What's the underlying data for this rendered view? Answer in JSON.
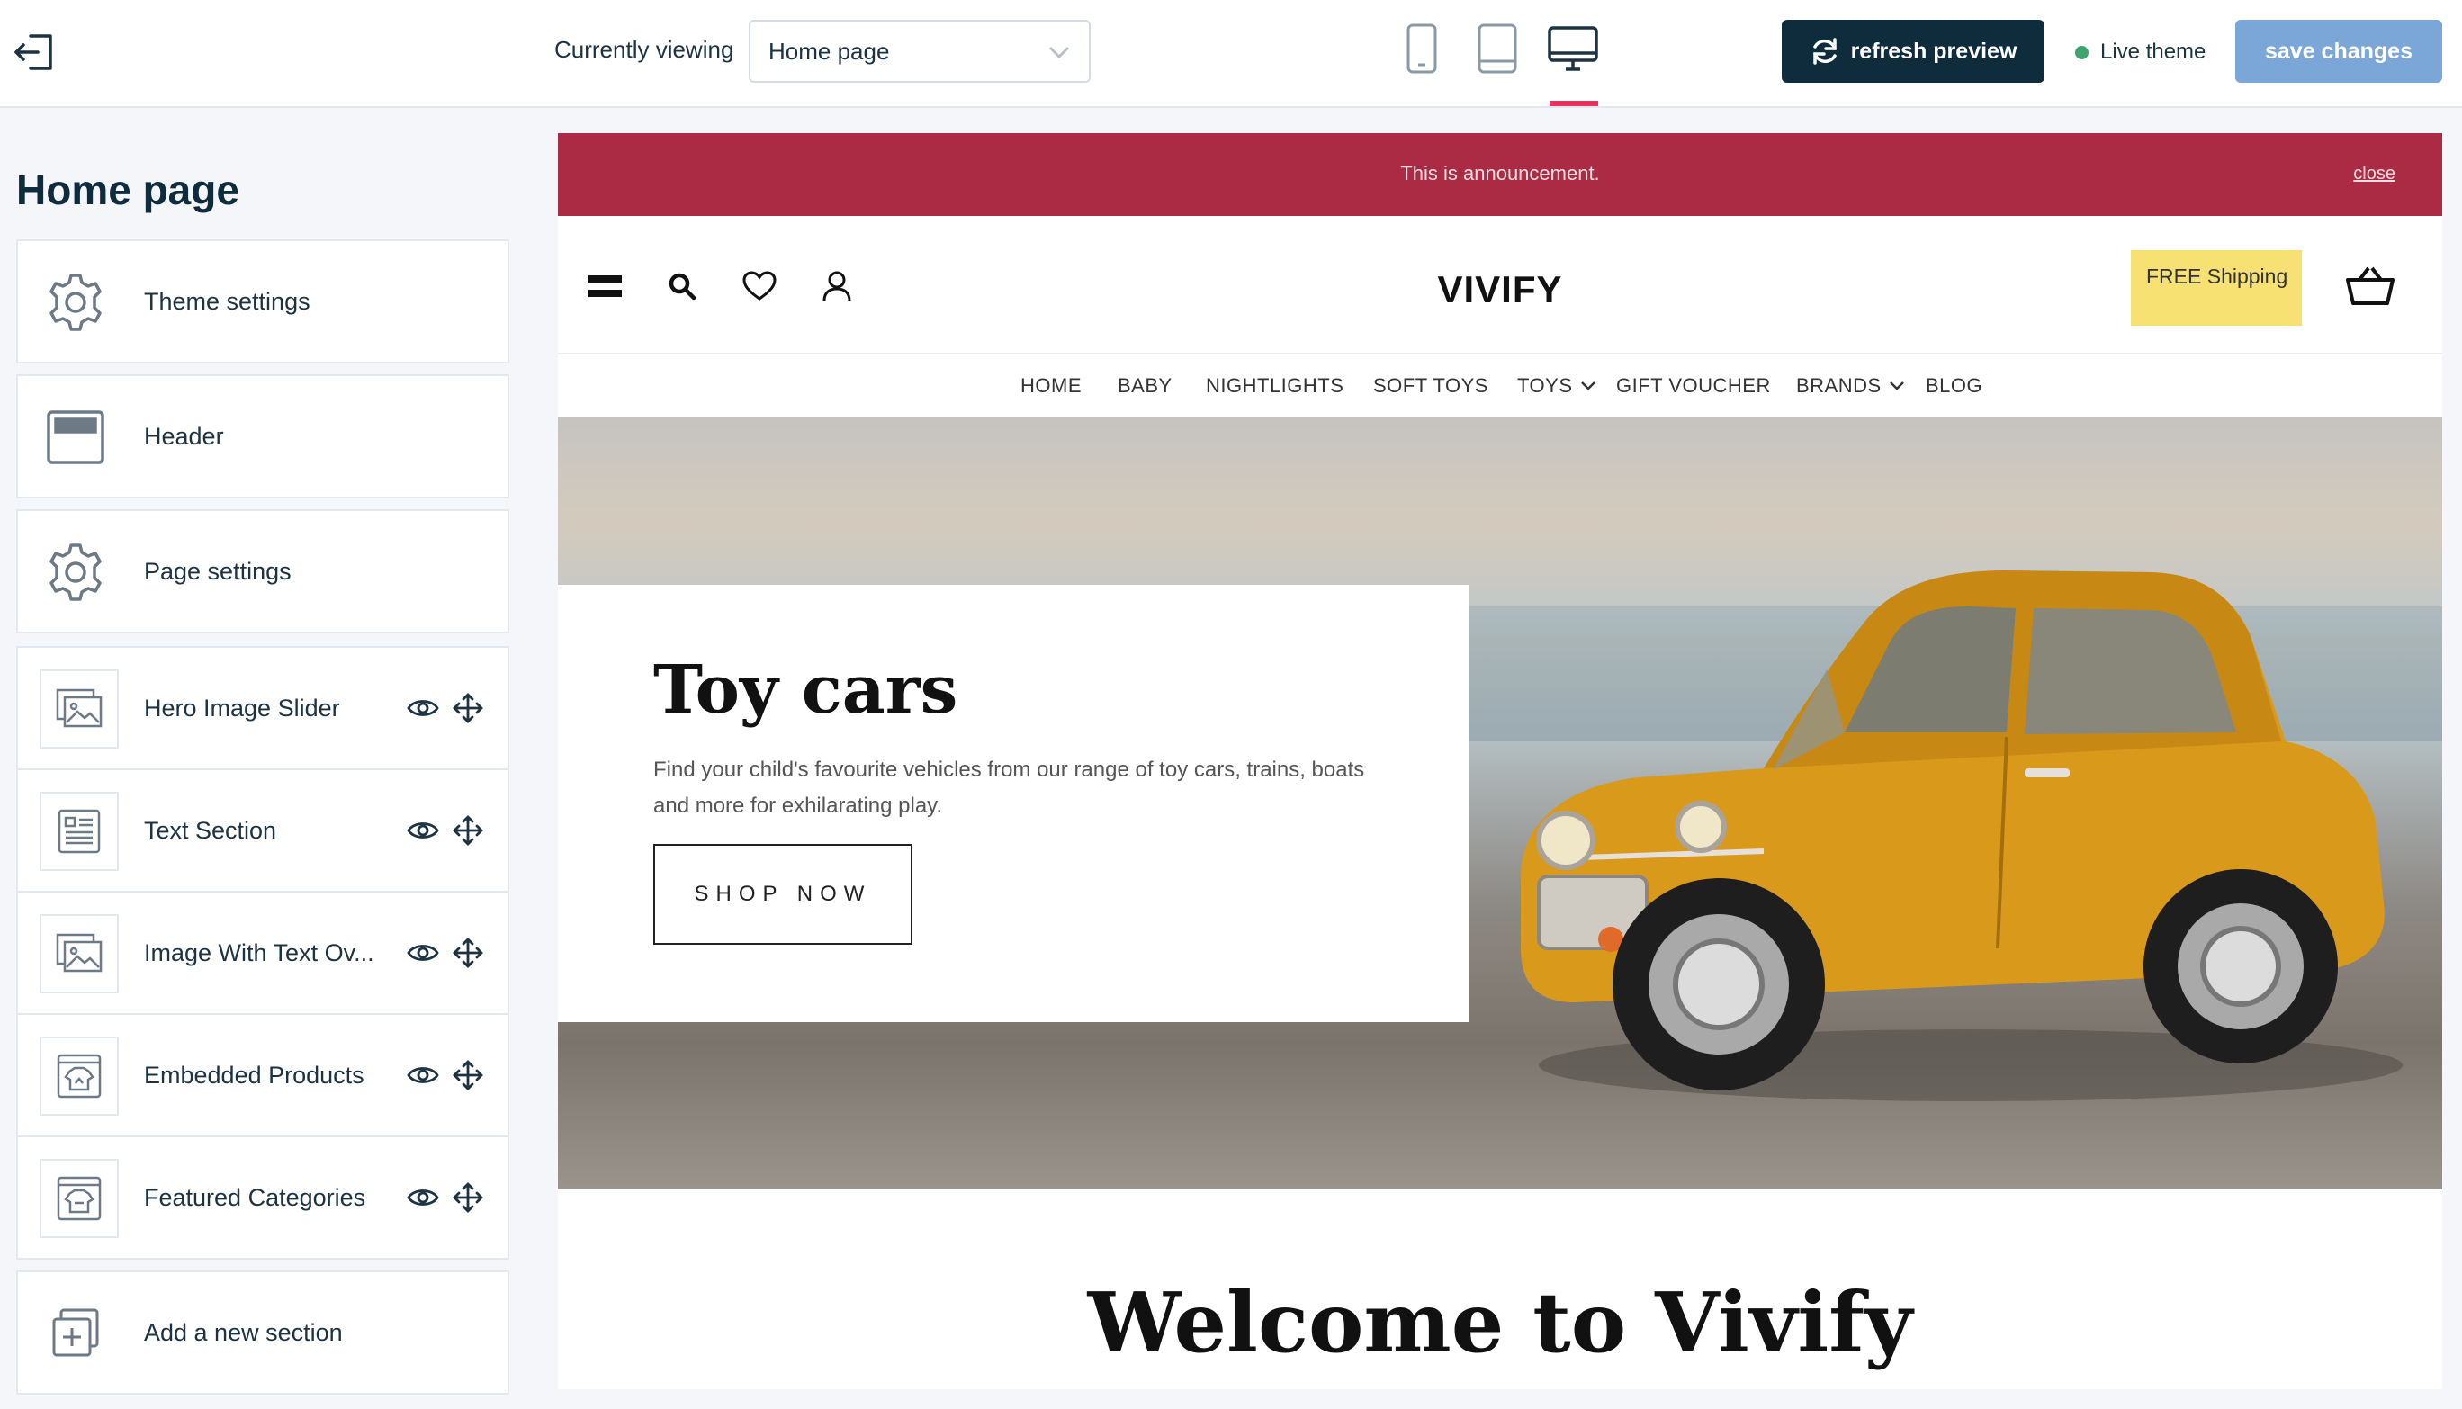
{
  "topbar": {
    "viewing_label": "Currently viewing",
    "page_select_value": "Home page",
    "refresh_label": "refresh preview",
    "live_label": "Live theme",
    "save_label": "save changes",
    "devices": [
      "mobile-icon",
      "tablet-icon",
      "desktop-icon"
    ],
    "active_device": "desktop"
  },
  "sidebar": {
    "title": "Home page",
    "items": [
      {
        "label": "Theme settings",
        "icon": "gear-icon"
      },
      {
        "label": "Header",
        "icon": "header-layout-icon"
      },
      {
        "label": "Page settings",
        "icon": "gear-icon"
      },
      {
        "label": "Hero Image Slider",
        "icon": "image-slider-icon"
      },
      {
        "label": "Text Section",
        "icon": "text-section-icon"
      },
      {
        "label": "Image With Text Ov...",
        "icon": "image-icon"
      },
      {
        "label": "Embedded Products",
        "icon": "products-icon"
      },
      {
        "label": "Featured Categories",
        "icon": "categories-icon"
      },
      {
        "label": "Add a new section",
        "icon": "add-section-icon"
      }
    ]
  },
  "preview": {
    "announcement": "This is announcement.",
    "announcement_close": "close",
    "logo": "VIVIFY",
    "free_shipping": "FREE Shipping",
    "nav": [
      "HOME",
      "BABY",
      "NIGHTLIGHTS",
      "SOFT TOYS",
      "TOYS",
      "GIFT VOUCHER",
      "BRANDS",
      "BLOG"
    ],
    "hero_title": "Toy cars",
    "hero_text": "Find your child's favourite vehicles from our range of toy cars, trains, boats and more for exhilarating play.",
    "hero_button": "SHOP NOW",
    "welcome": "Welcome to Vivify"
  },
  "colors": {
    "brand_dark": "#0f2c3d",
    "save_button": "#7aa7d8",
    "live_dot": "#3fa370",
    "active_tab": "#e8335d",
    "announcement_bg": "#ab2b44",
    "free_shipping_bg": "#f6e172"
  }
}
